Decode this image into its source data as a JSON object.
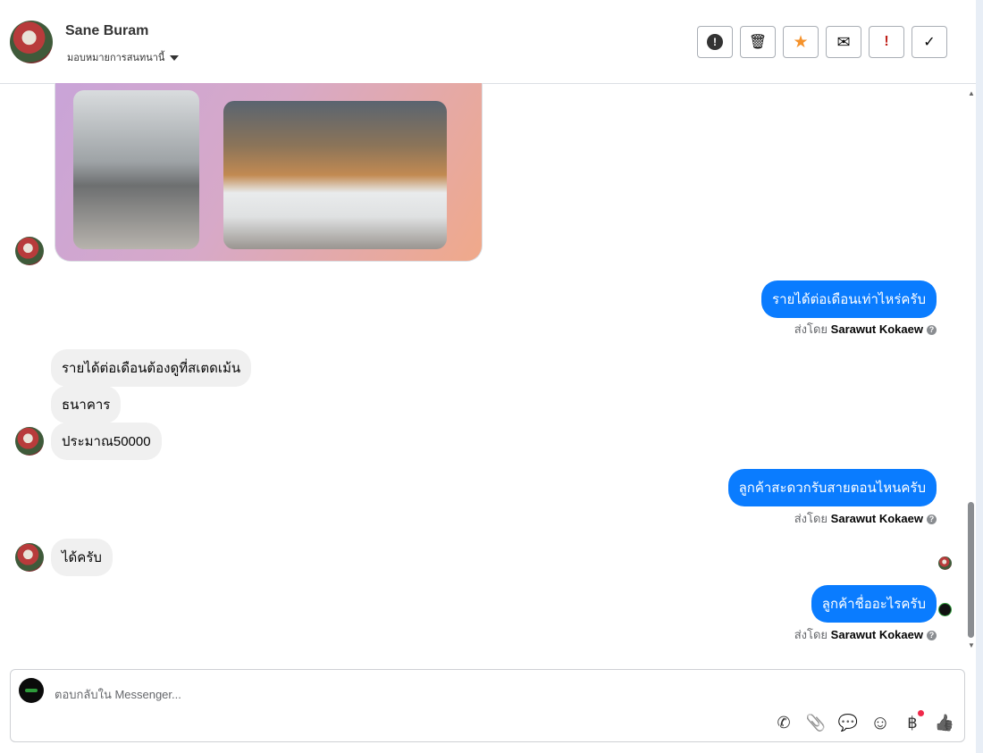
{
  "header": {
    "name": "Sane Buram",
    "assign_label": "มอบหมายการสนทนานี้"
  },
  "actions": [
    {
      "name": "spam",
      "icon": "!"
    },
    {
      "name": "delete",
      "icon": "🗑"
    },
    {
      "name": "star",
      "icon": "★",
      "color": "#f5922b"
    },
    {
      "name": "mark-unread",
      "icon": "✉"
    },
    {
      "name": "follow-up",
      "icon": "!",
      "color": "#c0221b"
    },
    {
      "name": "done",
      "icon": "✓"
    }
  ],
  "messages": {
    "out1": "รายได้ต่อเดือนเท่าไหร่ครับ",
    "in1": "รายได้ต่อเดือนต้องดูที่สเตดเม้น",
    "in2": "ธนาคาร",
    "in3": "ประมาณ50000",
    "out2": "ลูกค้าสะดวกรับสายตอนไหนครับ",
    "in4": "ได้ครับ",
    "out3": "ลูกค้าชื่ออะไรครับ"
  },
  "sent_by": {
    "prefix": "ส่งโดย",
    "name": "Sarawut Kokaew",
    "help": "?"
  },
  "composer": {
    "placeholder": "ตอบกลับใน Messenger..."
  },
  "tools": {
    "call": "✆",
    "attach": "📎",
    "saved": "💬",
    "emoji": "☺",
    "payment": "฿",
    "like": "👍"
  }
}
